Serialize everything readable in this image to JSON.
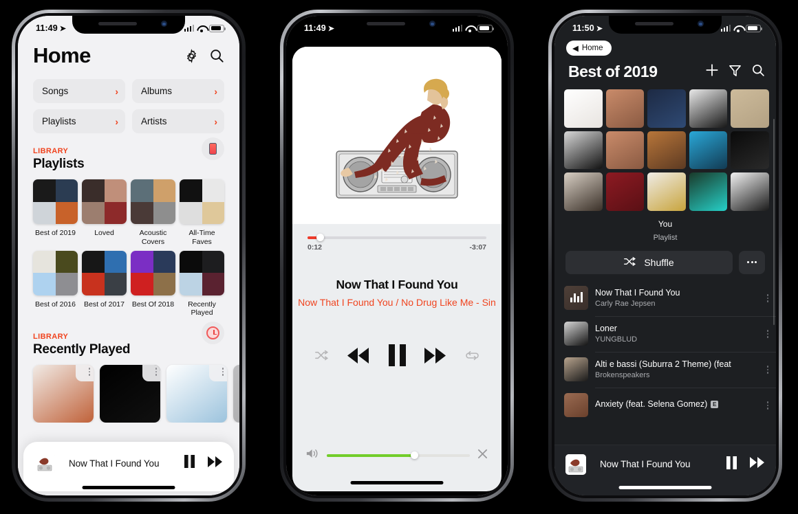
{
  "phone1": {
    "status": {
      "time": "11:49",
      "location_icon": "location-arrow-icon",
      "signal": "signal-bars-icon",
      "wifi": "wifi-icon",
      "battery": "battery-icon"
    },
    "header": {
      "title": "Home",
      "settings_icon": "gear-icon",
      "search_icon": "search-icon"
    },
    "quicklinks": [
      {
        "label": "Songs",
        "chevron": "›"
      },
      {
        "label": "Albums",
        "chevron": "›"
      },
      {
        "label": "Playlists",
        "chevron": "›"
      },
      {
        "label": "Artists",
        "chevron": "›"
      }
    ],
    "playlists_section": {
      "kicker": "LIBRARY",
      "title": "Playlists",
      "badge_icon": "iphone-icon"
    },
    "playlists": [
      {
        "name": "Best of 2019",
        "colors": [
          "#1a1a1a",
          "#2b3c52",
          "#cfd4d9",
          "#c8622a"
        ]
      },
      {
        "name": "Loved",
        "colors": [
          "#3a2d2a",
          "#c08f7a",
          "#9c7e6f",
          "#8d2a2a"
        ]
      },
      {
        "name": "Acoustic Covers",
        "colors": [
          "#5c6f78",
          "#cfa06a",
          "#4a3a37",
          "#8e8e8e"
        ]
      },
      {
        "name": "All-Time Faves",
        "colors": [
          "#111111",
          "#e8e8e8",
          "#dedede",
          "#dfc89a"
        ]
      },
      {
        "name": "Best of 2016",
        "colors": [
          "#e6e4dd",
          "#4a4a1e",
          "#aed2ef",
          "#8e8e92"
        ]
      },
      {
        "name": "Best of 2017",
        "colors": [
          "#171717",
          "#2f6fb0",
          "#c8321e",
          "#3a3f45"
        ]
      },
      {
        "name": "Best Of 2018",
        "colors": [
          "#7b2ec4",
          "#2a3a5a",
          "#cf2020",
          "#8d7049"
        ]
      },
      {
        "name": "Recently Played",
        "colors": [
          "#0b0b0b",
          "#1d1d1f",
          "#bcd3e4",
          "#5a2230"
        ]
      }
    ],
    "recently_section": {
      "kicker": "LIBRARY",
      "title": "Recently Played",
      "badge_icon": "recent-clock-icon"
    },
    "recently_played": [
      {
        "colors": [
          "#f1ebe6",
          "#c0623a"
        ],
        "menu_icon": "kebab-menu-icon"
      },
      {
        "colors": [
          "#000000",
          "#101010"
        ],
        "menu_icon": "kebab-menu-icon"
      },
      {
        "colors": [
          "#ffffff",
          "#9cc3dd"
        ],
        "menu_icon": "kebab-menu-icon"
      },
      {
        "colors": [
          "#bdbdbf",
          "#a8a8aa"
        ],
        "menu_icon": "kebab-menu-icon"
      }
    ],
    "miniplayer": {
      "title": "Now That I Found You",
      "pause_icon": "pause-icon",
      "next_icon": "fast-forward-icon"
    }
  },
  "phone2": {
    "status": {
      "time": "11:49",
      "location_icon": "location-arrow-icon",
      "signal": "signal-bars-icon",
      "wifi": "wifi-icon",
      "battery": "battery-icon"
    },
    "artwork_alt": "Carly Rae Jepsen Dedicated album artwork",
    "progress": {
      "elapsed": "0:12",
      "remaining": "-3:07",
      "percent": 6,
      "accent": "#ee3b2b"
    },
    "song_title": "Now That I Found You",
    "song_subtitle": "Now That I Found You / No Drug Like Me - Sin",
    "controls": {
      "shuffle_icon": "shuffle-icon",
      "previous_icon": "rewind-icon",
      "pause_icon": "pause-icon",
      "next_icon": "fast-forward-icon",
      "repeat_icon": "repeat-icon"
    },
    "volume": {
      "icon": "speaker-wave-icon",
      "percent": 61,
      "accent": "#72cd2a",
      "close_icon": "close-icon"
    }
  },
  "phone3": {
    "status": {
      "time": "11:50",
      "location_icon": "location-arrow-icon",
      "signal": "signal-bars-icon",
      "wifi": "wifi-icon",
      "battery": "battery-icon"
    },
    "back_label": "Home",
    "back_icon": "back-triangle-icon",
    "title": "Best of 2019",
    "actions": {
      "add_icon": "plus-icon",
      "filter_icon": "funnel-icon",
      "search_icon": "search-icon"
    },
    "tiles": [
      {
        "colors": [
          "#ffffff",
          "#e8e4e0"
        ]
      },
      {
        "colors": [
          "#c98b6a",
          "#8a5a42"
        ]
      },
      {
        "colors": [
          "#1d2a44",
          "#2f4a74"
        ]
      },
      {
        "colors": [
          "#e9e9e9",
          "#171717"
        ]
      },
      {
        "colors": [
          "#cdbb9b",
          "#b3a183"
        ]
      },
      {
        "colors": [
          "#d8d8d8",
          "#121212"
        ]
      },
      {
        "colors": [
          "#c98b6a",
          "#8a5a42"
        ]
      },
      {
        "colors": [
          "#b8763a",
          "#5d3a22"
        ]
      },
      {
        "colors": [
          "#2aa8d8",
          "#123a52"
        ]
      },
      {
        "colors": [
          "#0a0a0a",
          "#2a2a2a"
        ]
      },
      {
        "colors": [
          "#d8cfc4",
          "#3a3028"
        ]
      },
      {
        "colors": [
          "#8d1a22",
          "#5a1015"
        ]
      },
      {
        "colors": [
          "#efece6",
          "#c8a43c"
        ]
      },
      {
        "colors": [
          "#1a3a2a",
          "#26d0c8"
        ]
      },
      {
        "colors": [
          "#f2f2f2",
          "#1a1a1a"
        ]
      }
    ],
    "owner": "You",
    "kind": "Playlist",
    "shuffle_label": "Shuffle",
    "shuffle_icon": "shuffle-icon",
    "more_icon": "ellipsis-icon",
    "tracks": [
      {
        "title": "Now That I Found You",
        "artist": "Carly Rae Jepsen",
        "explicit": false,
        "playing": true,
        "colors": [
          "#8a6a55",
          "#5c4436"
        ]
      },
      {
        "title": "Loner",
        "artist": "YUNGBLUD",
        "explicit": false,
        "playing": false,
        "colors": [
          "#d6d6d6",
          "#121212"
        ]
      },
      {
        "title": "Alti e bassi (Suburra 2 Theme) (feat",
        "artist": "Brokenspeakers",
        "explicit": false,
        "playing": false,
        "colors": [
          "#b8a48e",
          "#1a1a1a"
        ]
      },
      {
        "title": "Anxiety (feat. Selena Gomez)",
        "artist": "",
        "explicit": true,
        "explicit_label": "E",
        "playing": false,
        "colors": [
          "#9a6b52",
          "#6a402c"
        ]
      }
    ],
    "miniplayer": {
      "title": "Now That I Found You",
      "pause_icon": "pause-icon",
      "next_icon": "fast-forward-icon"
    }
  }
}
